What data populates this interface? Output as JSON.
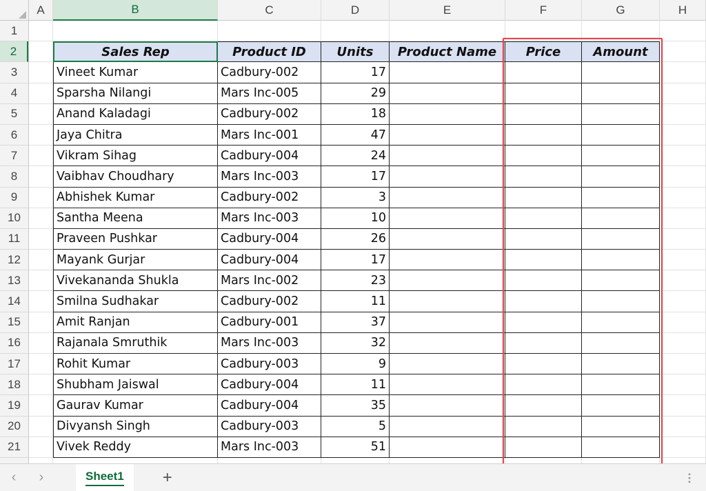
{
  "columns": [
    "A",
    "B",
    "C",
    "D",
    "E",
    "F",
    "G",
    "H"
  ],
  "selected_column": "B",
  "selected_row": "2",
  "header": [
    "Sales Rep",
    "Product ID",
    "Units",
    "Product Name",
    "Price",
    "Amount"
  ],
  "rows": [
    {
      "rep": "Vineet Kumar",
      "id": "Cadbury-002",
      "units": "17"
    },
    {
      "rep": "Sparsha Nilangi",
      "id": "Mars Inc-005",
      "units": "29"
    },
    {
      "rep": "Anand Kaladagi",
      "id": "Cadbury-002",
      "units": "18"
    },
    {
      "rep": "Jaya Chitra",
      "id": "Mars Inc-001",
      "units": "47"
    },
    {
      "rep": "Vikram Sihag",
      "id": "Cadbury-004",
      "units": "24"
    },
    {
      "rep": "Vaibhav Choudhary",
      "id": "Mars Inc-003",
      "units": "17"
    },
    {
      "rep": "Abhishek Kumar",
      "id": "Cadbury-002",
      "units": "3"
    },
    {
      "rep": "Santha Meena",
      "id": "Mars Inc-003",
      "units": "10"
    },
    {
      "rep": "Praveen Pushkar",
      "id": "Cadbury-004",
      "units": "26"
    },
    {
      "rep": "Mayank Gurjar",
      "id": "Cadbury-004",
      "units": "17"
    },
    {
      "rep": "Vivekananda Shukla",
      "id": "Mars Inc-002",
      "units": "23"
    },
    {
      "rep": "Smilna Sudhakar",
      "id": "Cadbury-002",
      "units": "11"
    },
    {
      "rep": "Amit Ranjan",
      "id": "Cadbury-001",
      "units": "37"
    },
    {
      "rep": "Rajanala Smruthik",
      "id": "Mars Inc-003",
      "units": "32"
    },
    {
      "rep": "Rohit Kumar",
      "id": "Cadbury-003",
      "units": "9"
    },
    {
      "rep": "Shubham Jaiswal",
      "id": "Cadbury-004",
      "units": "11"
    },
    {
      "rep": "Gaurav Kumar",
      "id": "Cadbury-004",
      "units": "35"
    },
    {
      "rep": "Divyansh Singh",
      "id": "Cadbury-003",
      "units": "5"
    },
    {
      "rep": "Vivek Reddy",
      "id": "Mars Inc-003",
      "units": "51"
    }
  ],
  "tabbar": {
    "prev_icon": "‹",
    "next_icon": "›",
    "sheet_tab": "Sheet1",
    "add_icon": "+"
  },
  "colors": {
    "accent": "#1d7a45",
    "header_fill": "#d9e1f2",
    "highlight": "#e0474c"
  }
}
